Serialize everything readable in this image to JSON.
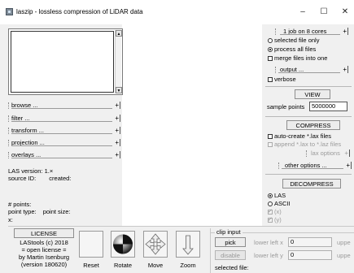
{
  "window": {
    "title": "laszip - lossless compression of LiDAR data",
    "minimize": "–",
    "maximize": "☐",
    "close": "✕"
  },
  "left": {
    "sections": [
      "browse ...",
      "filter ...",
      "transform ...",
      "projection ...",
      "overlays ..."
    ],
    "las_version": "LAS version: 1.×",
    "source_id": "source ID:",
    "created": "created:",
    "points": "# points:",
    "point_type": "point type:",
    "point_size": "point size:",
    "x_label": "x:"
  },
  "right": {
    "jobs": "1 job on 8 cores",
    "selected_file_only": "selected file only",
    "process_all_files": "process all files",
    "merge_files": "merge files into one",
    "output": "output ...",
    "verbose": "verbose",
    "view": "VIEW",
    "sample_points_label": "sample points",
    "sample_points_value": "5000000",
    "compress": "COMPRESS",
    "auto_create_lax": "auto-create *.lax files",
    "append_lax": "append *.lax to *.laz files",
    "lax_options": "lax options",
    "other_options": "other options ...",
    "decompress": "DECOMPRESS",
    "las": "LAS",
    "ascii": "ASCII",
    "opt_x": "(x)",
    "opt_y": "(y)"
  },
  "bottom": {
    "license_button": "LICENSE",
    "license_text": [
      "LAStools (c) 2018",
      "= open license =",
      "by Martin Isenburg",
      "(version 180620)"
    ],
    "tools": [
      "Reset",
      "Rotate",
      "Move",
      "Zoom"
    ],
    "clip_input": "clip input",
    "pick": "pick",
    "disable": "disable",
    "lower_left_x": "lower left x",
    "lower_left_y": "lower left y",
    "ll_x_value": "0",
    "ll_y_value": "0",
    "upper_cut": "uppe",
    "upper_cut2": "uppe",
    "selected_file": "selected file:"
  },
  "plus": "+"
}
